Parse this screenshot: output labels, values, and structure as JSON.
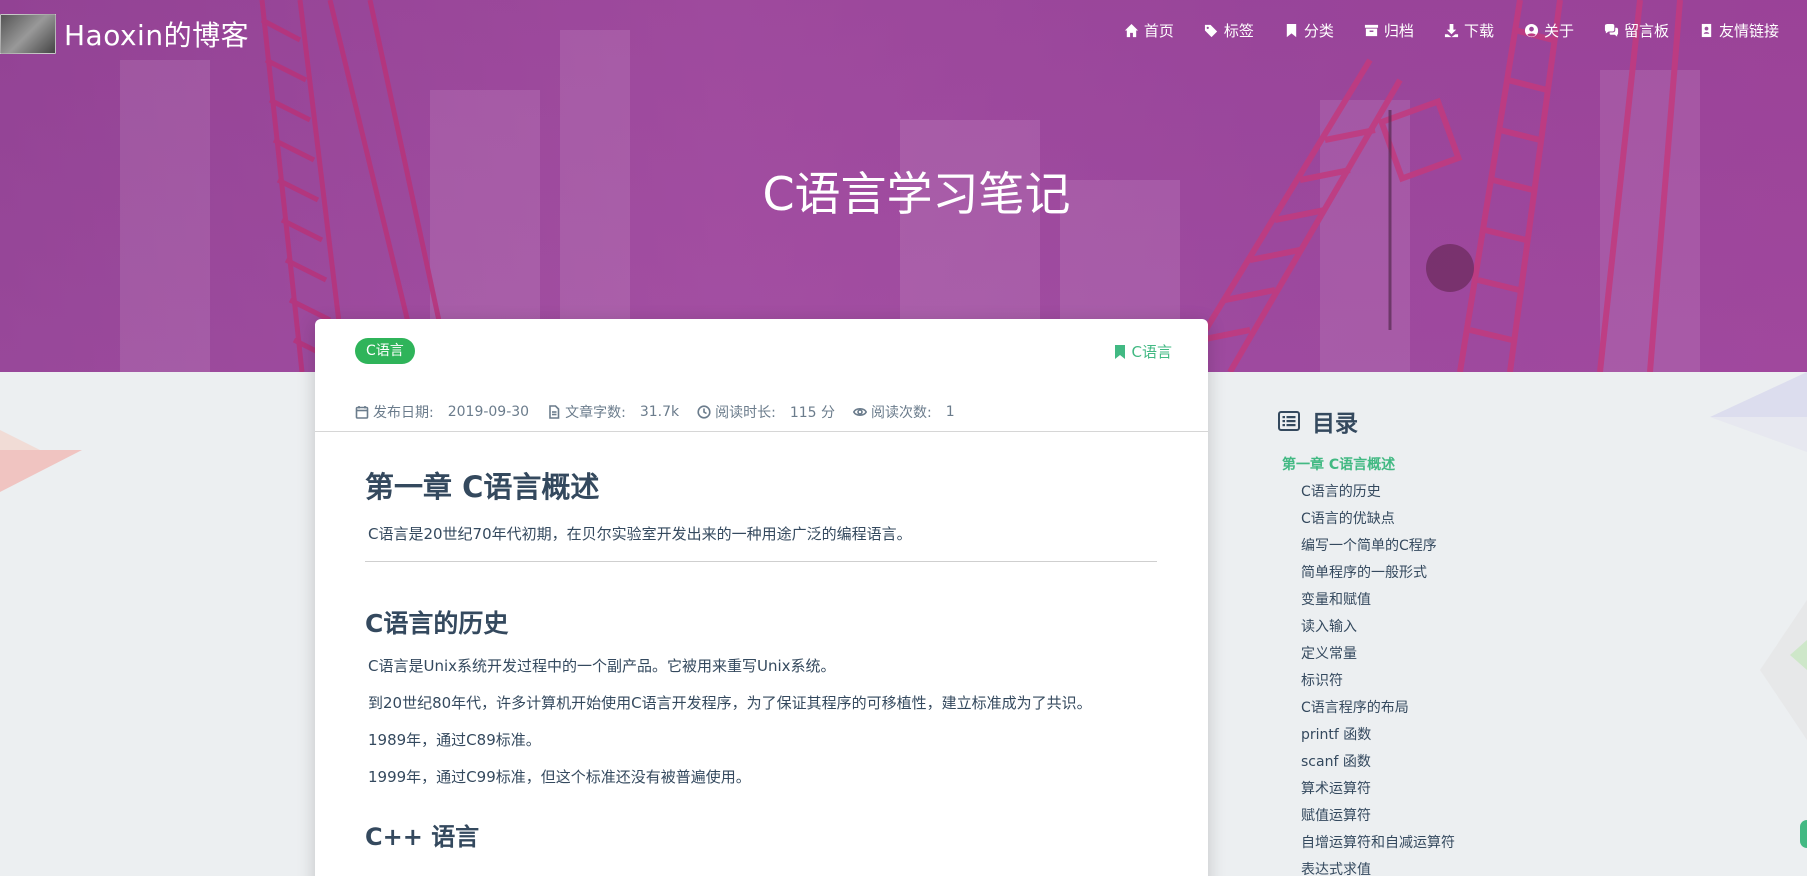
{
  "site": {
    "logo_text": "Haoxin的博客"
  },
  "nav": [
    {
      "label": "首页",
      "icon": "home-icon"
    },
    {
      "label": "标签",
      "icon": "tags-icon"
    },
    {
      "label": "分类",
      "icon": "bookmark-icon"
    },
    {
      "label": "归档",
      "icon": "archive-icon"
    },
    {
      "label": "下载",
      "icon": "download-icon"
    },
    {
      "label": "关于",
      "icon": "user-circle-icon"
    },
    {
      "label": "留言板",
      "icon": "comments-icon"
    },
    {
      "label": "友情链接",
      "icon": "address-book-icon"
    }
  ],
  "hero": {
    "title": "C语言学习笔记"
  },
  "post": {
    "tag": "C语言",
    "category": "C语言",
    "meta": {
      "date_label": "发布日期:",
      "date_value": "2019-09-30",
      "words_label": "文章字数:",
      "words_value": "31.7k",
      "read_label": "阅读时长:",
      "read_value": "115 分",
      "views_label": "阅读次数:",
      "views_value": "1"
    },
    "h1": "第一章 C语言概述",
    "intro": "C语言是20世纪70年代初期，在贝尔实验室开发出来的一种用途广泛的编程语言。",
    "h2_history": "C语言的历史",
    "history": [
      "C语言是Unix系统开发过程中的一个副产品。它被用来重写Unix系统。",
      "到20世纪80年代，许多计算机开始使用C语言开发程序，为了保证其程序的可移植性，建立标准成为了共识。",
      "1989年，通过C89标准。",
      "1999年，通过C99标准，但这个标准还没有被普遍使用。"
    ],
    "h2_cpp": "C++ 语言"
  },
  "toc": {
    "title": "目录",
    "items": [
      "第一章 C语言概述",
      "C语言的历史",
      "C语言的优缺点",
      "编写一个简单的C程序",
      "简单程序的一般形式",
      "变量和赋值",
      "读入输入",
      "定义常量",
      "标识符",
      "C语言程序的布局",
      "printf 函数",
      "scanf 函数",
      "算术运算符",
      "赋值运算符",
      "自增运算符和自减运算符",
      "表达式求值"
    ]
  },
  "colors": {
    "accent": "#42b983",
    "tag_bg": "#2fb45a",
    "hero": "#9b4f9e",
    "text": "#34495e"
  }
}
